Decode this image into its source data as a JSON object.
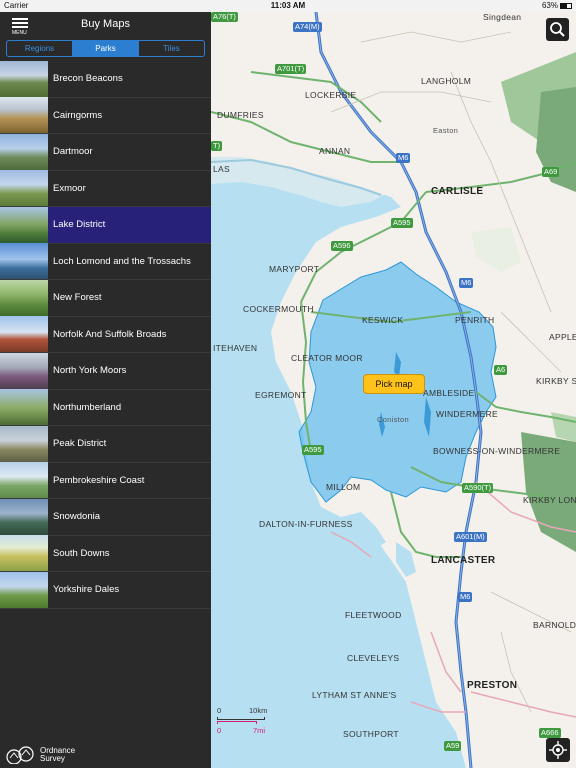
{
  "status": {
    "carrier": "Carrier",
    "time": "11:03 AM",
    "battery": "63%"
  },
  "header": {
    "menu_label": "MENU",
    "title": "Buy Maps"
  },
  "tabs": [
    {
      "label": "Regions",
      "active": false
    },
    {
      "label": "Parks",
      "active": true
    },
    {
      "label": "Tiles",
      "active": false
    }
  ],
  "parks": [
    {
      "name": "Brecon Beacons",
      "selected": false
    },
    {
      "name": "Cairngorms",
      "selected": false
    },
    {
      "name": "Dartmoor",
      "selected": false
    },
    {
      "name": "Exmoor",
      "selected": false
    },
    {
      "name": "Lake District",
      "selected": true
    },
    {
      "name": "Loch Lomond and the Trossachs",
      "selected": false
    },
    {
      "name": "New Forest",
      "selected": false
    },
    {
      "name": "Norfolk And Suffolk Broads",
      "selected": false
    },
    {
      "name": "North York Moors",
      "selected": false
    },
    {
      "name": "Northumberland",
      "selected": false
    },
    {
      "name": "Peak District",
      "selected": false
    },
    {
      "name": "Pembrokeshire Coast",
      "selected": false
    },
    {
      "name": "Snowdonia",
      "selected": false
    },
    {
      "name": "South Downs",
      "selected": false
    },
    {
      "name": "Yorkshire Dales",
      "selected": false
    }
  ],
  "logo": {
    "line1": "Ordnance",
    "line2": "Survey"
  },
  "map": {
    "pick_button": "Pick map",
    "scale_km": {
      "zero": "0",
      "value": "10km"
    },
    "scale_mi": {
      "zero": "0",
      "value": "7mi"
    },
    "places": {
      "singdean": "Singdean",
      "langholm": "LANGHOLM",
      "lockerbie": "LOCKERBIE",
      "dumfries": "DUMFRIES",
      "annan": "ANNAN",
      "easton": "Easton",
      "carlisle": "CARLISLE",
      "las": "LAS",
      "maryport": "MARYPORT",
      "cockermouth": "COCKERMOUTH",
      "keswick": "KESWICK",
      "penrith": "PENRITH",
      "itehaven": "ITEHAVEN",
      "cleator_moor": "CLEATOR MOOR",
      "appleby": "APPLE",
      "kirkby_st": "KIRKBY S",
      "egremont": "EGREMONT",
      "ambleside": "AMBLESIDE",
      "coniston": "Coniston",
      "windermere": "WINDERMERE",
      "bowness": "BOWNESS-ON-WINDERMERE",
      "kirkby_lon": "KIRKBY LON",
      "millom": "MILLOM",
      "dalton": "DALTON-IN-FURNESS",
      "lancaster": "LANCASTER",
      "fleetwood": "FLEETWOOD",
      "barnold": "BARNOLD",
      "cleveleys": "CLEVELEYS",
      "lytham": "LYTHAM ST ANNE'S",
      "preston": "PRESTON",
      "southport": "SOUTHPORT"
    },
    "roads": {
      "a76": "A76(T)",
      "a74m": "A74(M)",
      "a701": "A701(T)",
      "t_left": "T)",
      "m6_top": "M6",
      "a69": "A69",
      "a595_top": "A595",
      "a596": "A596",
      "m6_mid": "M6",
      "a6": "A6",
      "a595_low": "A595",
      "a590": "A590(T)",
      "a601m": "A601(M)",
      "m6_low": "M6",
      "a59": "A59",
      "a666": "A666"
    }
  }
}
